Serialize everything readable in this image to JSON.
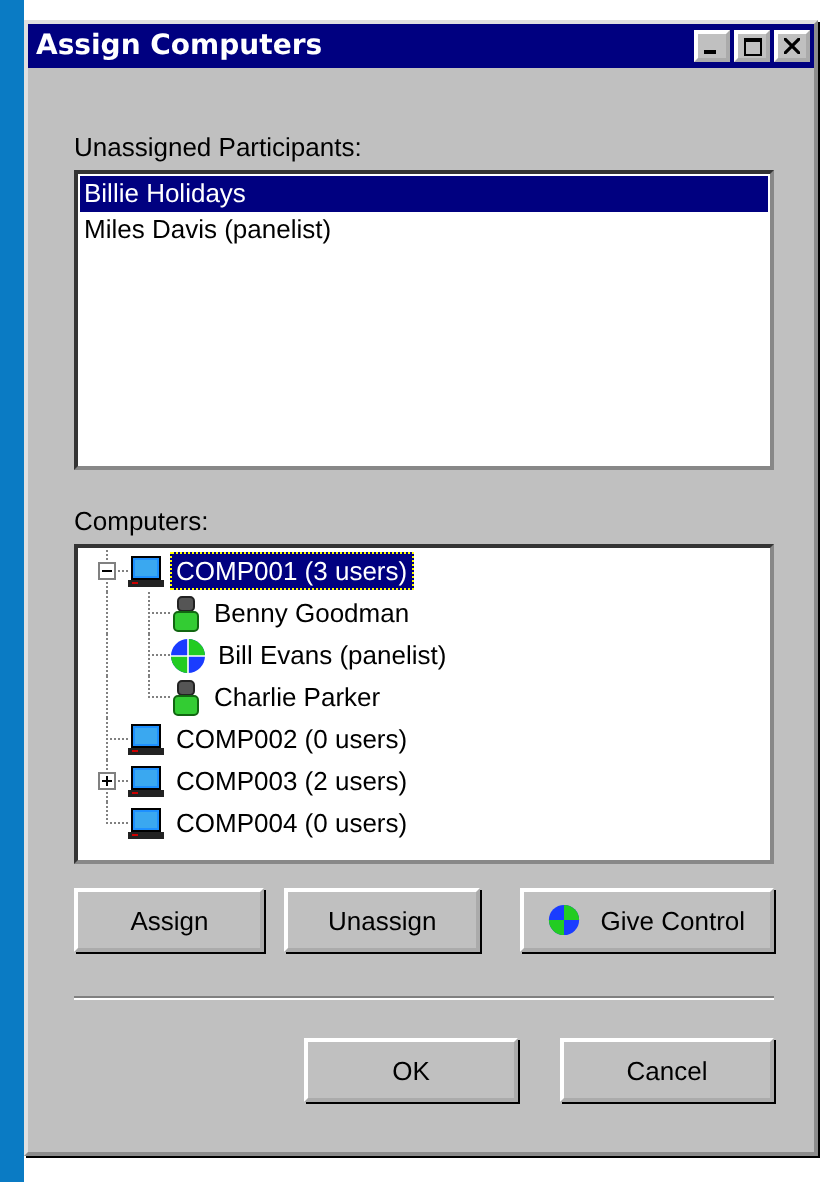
{
  "window": {
    "title": "Assign Computers"
  },
  "participants": {
    "label": "Unassigned Participants:",
    "items": [
      {
        "name": "Billie Holidays",
        "selected": true
      },
      {
        "name": "Miles Davis (panelist)",
        "selected": false
      }
    ]
  },
  "computers": {
    "label": "Computers:",
    "tree": [
      {
        "kind": "computer",
        "label": "COMP001 (3 users)",
        "selected": true,
        "expanded": true,
        "children": [
          {
            "kind": "person",
            "label": "Benny Goodman",
            "selected": false
          },
          {
            "kind": "panelist",
            "label": "Bill Evans (panelist)",
            "selected": false
          },
          {
            "kind": "person",
            "label": "Charlie Parker",
            "selected": false
          }
        ]
      },
      {
        "kind": "computer",
        "label": "COMP002 (0 users)",
        "selected": false
      },
      {
        "kind": "computer",
        "label": "COMP003 (2 users)",
        "selected": false,
        "expanded": false
      },
      {
        "kind": "computer",
        "label": "COMP004 (0 users)",
        "selected": false
      }
    ]
  },
  "actions": [
    "Assign",
    "Unassign",
    "Give Control"
  ],
  "buttons": [
    "OK",
    "Cancel"
  ]
}
